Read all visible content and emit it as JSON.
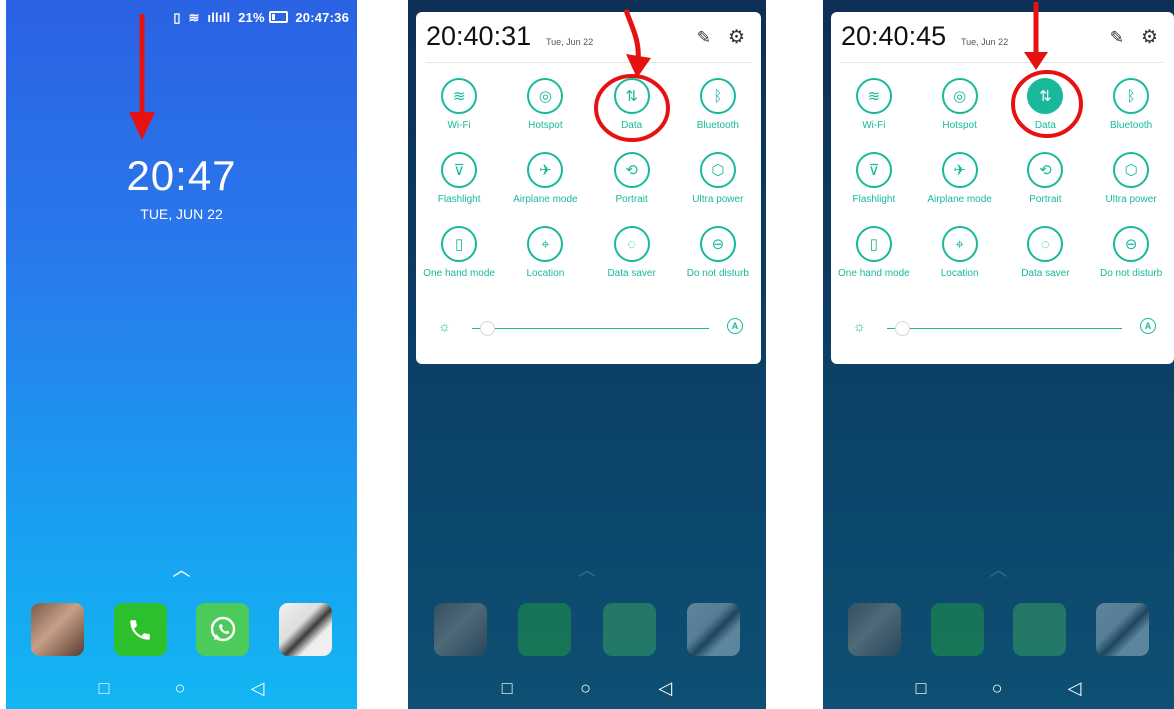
{
  "lock": {
    "status_time": "20:47:36",
    "battery": "21%",
    "time": "20:47",
    "date": "TUE, JUN 22"
  },
  "qs_before": {
    "time": "20:40:31",
    "date": "Tue, Jun 22"
  },
  "qs_after": {
    "time": "20:40:45",
    "date": "Tue, Jun 22"
  },
  "tiles": [
    {
      "label": "Wi-Fi",
      "icon": "wifi-icon"
    },
    {
      "label": "Hotspot",
      "icon": "hotspot-icon"
    },
    {
      "label": "Data",
      "icon": "data-icon"
    },
    {
      "label": "Bluetooth",
      "icon": "bluetooth-icon"
    },
    {
      "label": "Flashlight",
      "icon": "flashlight-icon"
    },
    {
      "label": "Airplane mode",
      "icon": "airplane-icon"
    },
    {
      "label": "Portrait",
      "icon": "rotate-icon"
    },
    {
      "label": "Ultra power",
      "icon": "power-save-icon"
    },
    {
      "label": "One hand mode",
      "icon": "one-hand-icon"
    },
    {
      "label": "Location",
      "icon": "location-icon"
    },
    {
      "label": "Data saver",
      "icon": "data-saver-icon"
    },
    {
      "label": "Do not disturb",
      "icon": "dnd-icon"
    }
  ],
  "colors": {
    "accent": "#17b99a",
    "annotation": "#e61212",
    "lock_bg": "#2a62e4"
  }
}
